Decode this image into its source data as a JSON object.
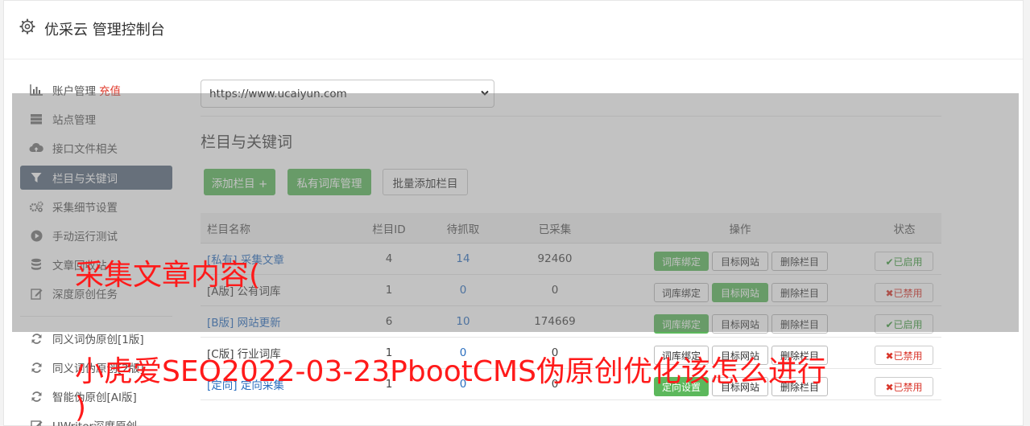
{
  "header": {
    "title": "优采云 管理控制台",
    "icon": "gear-icon"
  },
  "sidebar": {
    "items": [
      {
        "label": "账户管理",
        "extra": "充值",
        "icon": "bar-chart-icon"
      },
      {
        "label": "站点管理",
        "icon": "server-icon"
      },
      {
        "label": "接口文件相关",
        "icon": "cloud-upload-icon"
      },
      {
        "label": "栏目与关键词",
        "icon": "filter-icon"
      },
      {
        "label": "采集细节设置",
        "icon": "cogs-icon"
      },
      {
        "label": "手动运行测试",
        "icon": "play-circle-icon"
      },
      {
        "label": "文章回收站",
        "icon": "database-icon"
      },
      {
        "label": "深度原创任务",
        "icon": "edit-icon"
      },
      {
        "label": "同义词伪原创[1版]",
        "icon": "refresh-icon"
      },
      {
        "label": "同义词伪原创[2版]",
        "icon": "refresh-icon"
      },
      {
        "label": "智能伪原创[AI版]",
        "icon": "refresh-icon"
      },
      {
        "label": "UWriter深度原创",
        "icon": "edit-icon"
      }
    ]
  },
  "main": {
    "site_select": "https://www.ucaiyun.com",
    "section_title": "栏目与关键词",
    "buttons": {
      "add": "添加栏目 +",
      "private_lib": "私有词库管理",
      "batch_add": "批量添加栏目"
    },
    "table": {
      "headers": [
        "栏目名称",
        "栏目ID",
        "待抓取",
        "已采集",
        "操作",
        "状态"
      ],
      "ops": {
        "bind": "词库绑定",
        "target": "目标网站",
        "delete": "删除栏目",
        "redirect": "定向设置"
      },
      "status": {
        "on": "✔已启用",
        "off": "✖已禁用"
      },
      "rows": [
        {
          "name": "[私有] 采集文章",
          "id": "4",
          "pending": "14",
          "collected": "92460"
        },
        {
          "name": "[A版] 公有词库",
          "id": "1",
          "pending": "0",
          "collected": "0"
        },
        {
          "name": "[B版] 网站更新",
          "id": "6",
          "pending": "10",
          "collected": "174669"
        },
        {
          "name": "[C版] 行业词库",
          "id": "1",
          "pending": "0",
          "collected": "0"
        },
        {
          "name": "[定向] 定向采集",
          "id": "1",
          "pending": "0",
          "collected": "0"
        }
      ]
    }
  },
  "watermark": {
    "line1": "采集文章内容(",
    "line2": "小虎爱SEO2022-03-23PbootCMS伪原创优化该怎么进行",
    "line3": ")"
  },
  "colors": {
    "green": "#5cb85c",
    "active_nav": "#5a6b7e",
    "red": "#ff1a1a",
    "link": "#2a6ebf"
  }
}
